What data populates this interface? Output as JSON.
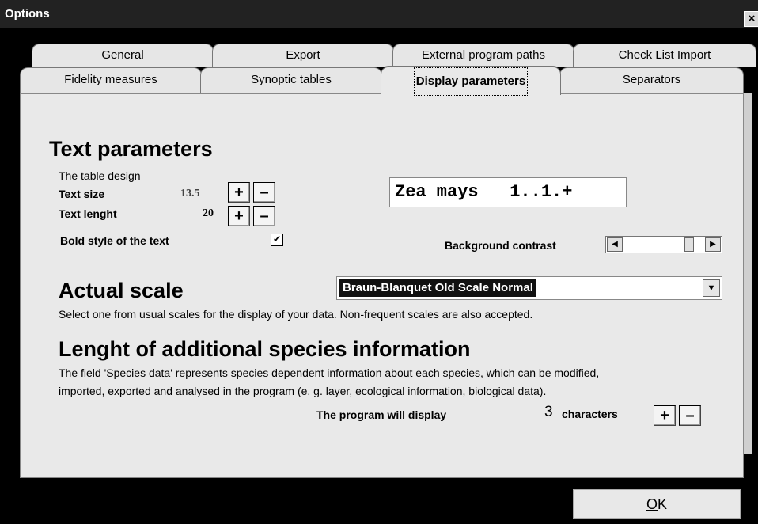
{
  "window": {
    "title": "Options",
    "close_label": "×"
  },
  "tabs_row1": [
    {
      "label": "General"
    },
    {
      "label": "Export"
    },
    {
      "label": "External program paths"
    },
    {
      "label": "Check List Import"
    }
  ],
  "tabs_row2": [
    {
      "label": "Fidelity measures"
    },
    {
      "label": "Synoptic tables"
    },
    {
      "label": "Display parameters",
      "active": true
    },
    {
      "label": "Separators"
    }
  ],
  "text_params": {
    "heading": "Text parameters",
    "subtitle": "The table design",
    "size_label": "Text size",
    "size_value": "13.5",
    "length_label": "Text lenght",
    "length_value": "20",
    "bold_label": "Bold style of the text",
    "bold_checked": true,
    "preview_text": "Zea mays   1..1.+",
    "background_label": "Background contrast",
    "background_level": 0.85
  },
  "scale": {
    "heading": "Actual scale",
    "selected": "Braun-Blanquet Old Scale Normal",
    "description": "Select one from usual scales for the display of your data. Non-frequent scales are also accepted."
  },
  "species": {
    "heading": "Lenght of additional species information",
    "line1": "The field 'Species data' represents species dependent information about each species, which can be modified,",
    "line2": "imported, exported and analysed in the program (e. g. layer, ecological information, biological data).",
    "display_label": "The program will display",
    "count": "3",
    "unit": "characters"
  },
  "buttons": {
    "plus": "+",
    "minus": "–",
    "ok": "OK"
  },
  "icons": {
    "check": "check-icon",
    "left": "arrow-left-icon",
    "right": "arrow-right-icon",
    "down": "arrow-down-icon"
  }
}
